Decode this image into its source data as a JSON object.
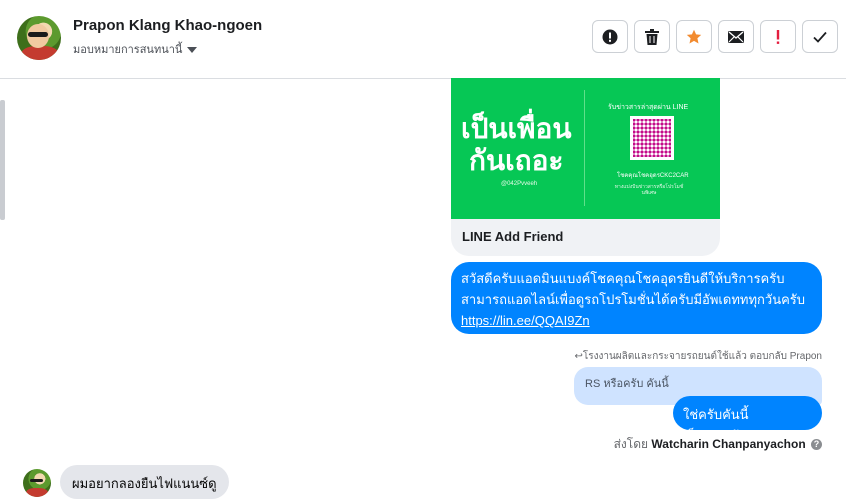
{
  "header": {
    "contact_name": "Prapon Klang Khao-ngoen",
    "assign_label": "มอบหมายการสนทนานี้",
    "actions": [
      {
        "icon": "alert-circle-icon",
        "color": "#1c1e21"
      },
      {
        "icon": "trash-icon",
        "color": "#1c1e21"
      },
      {
        "icon": "star-icon",
        "color": "#f28b30"
      },
      {
        "icon": "envelope-icon",
        "color": "#1c1e21"
      },
      {
        "icon": "exclamation-icon",
        "color": "#e41e3f"
      },
      {
        "icon": "checkmark-icon",
        "color": "#1c1e21"
      }
    ]
  },
  "card": {
    "image_big_line1": "เป็นเพื่อน",
    "image_big_line2": "กันเถอะ",
    "image_small": "@042Pvveeh",
    "image_right_title": "รับข่าวสารล่าสุดผ่าน LINE",
    "image_right_code": "โชคคุณโชคอุดรCKC2CAR",
    "image_right_note": "ทางแบ่งปันข่าวสารหรือโปรโมชั่นพิเศษ",
    "title": "LINE Add Friend",
    "accent": "#06c755"
  },
  "messages": {
    "outgoing_1_line1": "สวัสดีครับแอดมินแบงค์โชคคุณโชคอุดรยินดีให้บริการครับ",
    "outgoing_1_line2": "สามารถแอดไลน์เพื่อดูรถโปรโมชั่นได้ครับมีอัพเดทททุกวันครับ",
    "outgoing_1_link": "https://lin.ee/QQAI9Zn",
    "reply_context": "โรงงานผลิตและกระจายรถยนต์ใช้แล้ว ตอบกลับ Prapon",
    "reply_quote": "RS หรือครับ คันนี้",
    "outgoing_2": "ใช่ครับคันนี้เป็นRSครับ",
    "sent_by_prefix": "ส่งโดย",
    "sent_by_name": "Watcharin Chanpanyachon",
    "incoming_1": "ผมอยากลองยืนไฟแนนซ์ดู"
  },
  "colors": {
    "outgoing_bubble": "#0084ff",
    "reply_quote_bg": "#cfe3ff",
    "incoming_bubble": "#e4e6eb"
  }
}
